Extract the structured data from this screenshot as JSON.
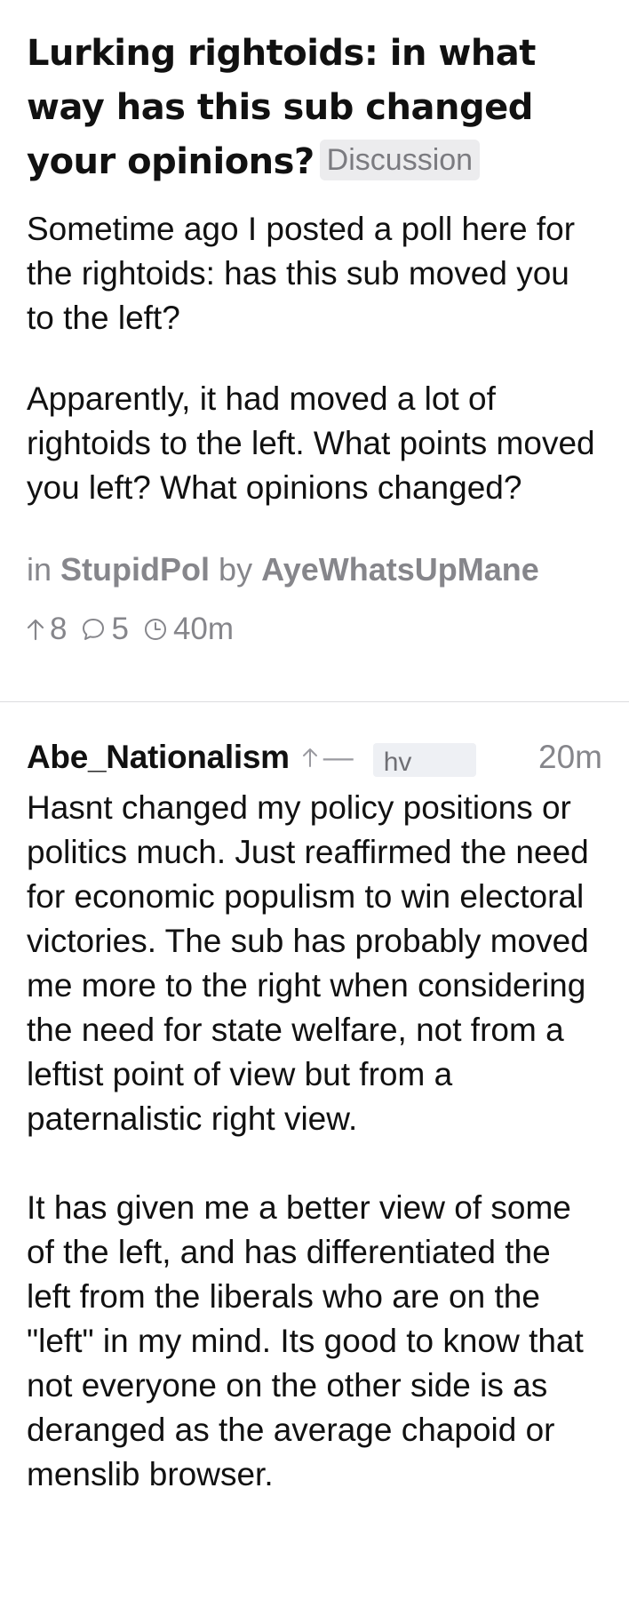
{
  "post": {
    "title": "Lurking rightoids: in what way has this sub changed your opinions?",
    "flair": "Discussion",
    "body": [
      "Sometime ago I posted a poll here for the rightoids: has this sub moved you to the left?",
      "Apparently, it had moved a lot of rightoids to the left. What points moved you left? What opinions changed?"
    ],
    "meta": {
      "in_label": "in",
      "subreddit": "StupidPol",
      "by_label": "by",
      "author": "AyeWhatsUpMane"
    },
    "stats": {
      "upvotes": "8",
      "comments": "5",
      "age": "40m"
    }
  },
  "comment": {
    "author": "Abe_Nationalism",
    "vote_score": "—",
    "user_flair": "hv",
    "time": "20m",
    "body": [
      "Hasnt changed my policy positions or politics much. Just reaffirmed the need for economic populism to win electoral victories. The sub has probably moved me more to the right when considering the need for state welfare, not from a leftist point of view but from a paternalistic right view.",
      "It has given me a better view of some of the left, and has differentiated the left from the liberals who are on the \"left\" in my mind. Its good to know that not everyone on the other side is as deranged as the average chapoid or menslib browser."
    ]
  },
  "icons": {
    "upvote": "arrow-up-icon",
    "comments": "speech-bubble-icon",
    "age": "clock-icon"
  },
  "colors": {
    "text": "#111111",
    "muted": "#86868b",
    "flair_bg": "#ececee",
    "divider": "#dcdcdf"
  }
}
